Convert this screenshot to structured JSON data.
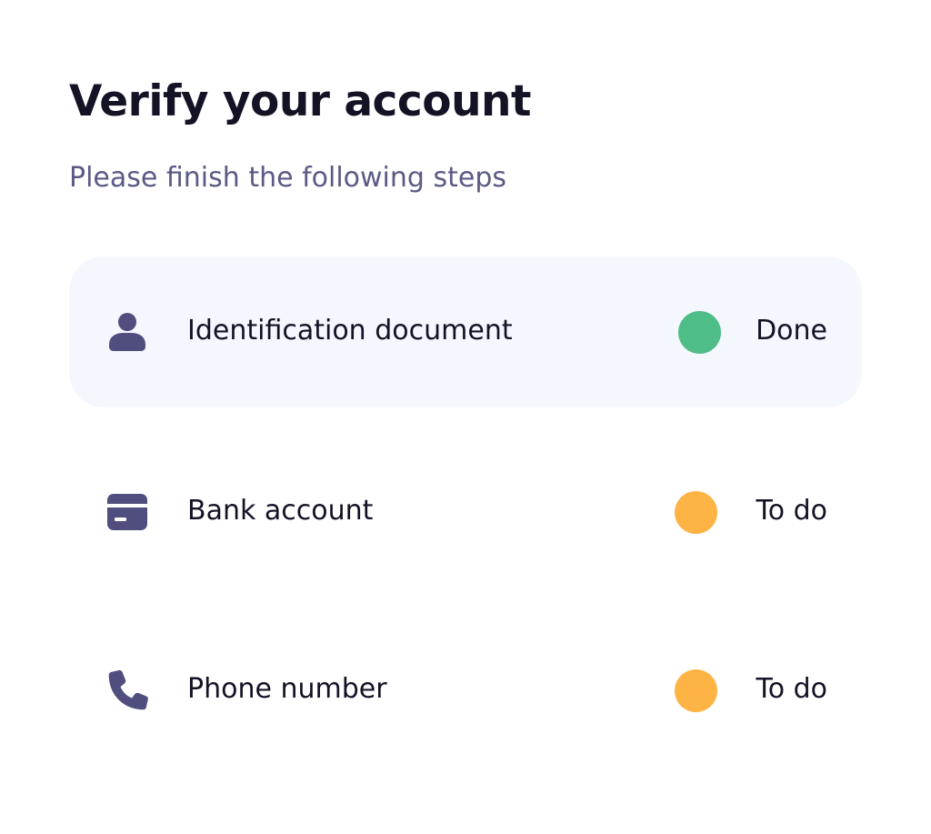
{
  "header": {
    "title": "Verify your account",
    "subtitle": "Please finish the following steps"
  },
  "colors": {
    "done": "#4ebd87",
    "todo": "#fdb444",
    "icon": "#4f4e7e",
    "active_bg": "#f4f7fe",
    "subtitle": "#5b5a85"
  },
  "steps": [
    {
      "label": "Identification document",
      "status": "Done",
      "state": "done",
      "icon": "user-icon",
      "active": true
    },
    {
      "label": "Bank account",
      "status": "To do",
      "state": "todo",
      "icon": "credit-card-icon",
      "active": false
    },
    {
      "label": "Phone number",
      "status": "To do",
      "state": "todo",
      "icon": "phone-icon",
      "active": false
    }
  ]
}
